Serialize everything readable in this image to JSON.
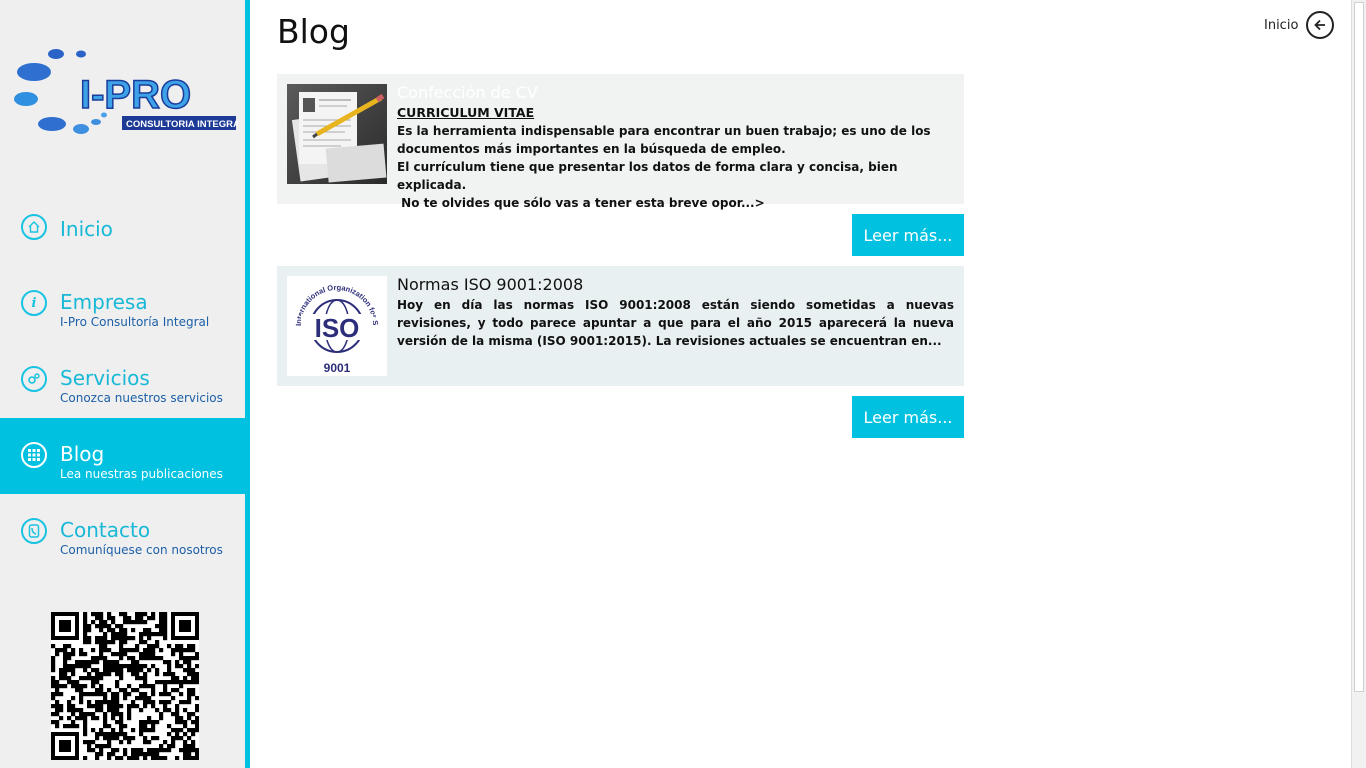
{
  "brand": {
    "logo_text": "I-PRO",
    "logo_tagline": "CONSULTORIA INTEGRAL",
    "primary_color": "#00c2e0",
    "link_color": "#1c5fa8"
  },
  "sidebar": {
    "items": [
      {
        "title": "Inicio",
        "subtitle": "",
        "icon": "home-icon"
      },
      {
        "title": "Empresa",
        "subtitle": "I-Pro Consultoría Integral",
        "icon": "info-icon"
      },
      {
        "title": "Servicios",
        "subtitle": "Conozca nuestros servicios",
        "icon": "gears-icon"
      },
      {
        "title": "Blog",
        "subtitle": "Lea nuestras publicaciones",
        "icon": "grid-icon",
        "active": true
      },
      {
        "title": "Contacto",
        "subtitle": "Comuníquese con nosotros",
        "icon": "phone-icon"
      }
    ]
  },
  "header": {
    "page_title": "Blog",
    "home_link_label": "Inicio"
  },
  "posts": [
    {
      "title": "Confección de CV",
      "subheading": "CURRICULUM VITAE",
      "excerpt_lines": [
        "Es la herramienta indispensable para encontrar un buen trabajo; es uno de los",
        "documentos más importantes en la búsqueda de empleo.",
        "El currículum tiene que presentar los datos de forma clara y concisa, bien explicada.",
        " No te olvides que sólo vas a tener esta breve opor...>"
      ],
      "read_more": "Leer más..."
    },
    {
      "title": "Normas ISO 9001:2008",
      "thumb_ring_text": "International Organization for Standardization",
      "thumb_main": "ISO",
      "thumb_number": "9001",
      "excerpt": "Hoy en día las normas ISO 9001:2008 están siendo sometidas a nuevas revisiones, y todo parece apuntar a que para el año 2015 aparecerá la nueva versión de la misma (ISO 9001:2015). La revisiones actuales se encuentran en...",
      "read_more": "Leer más..."
    }
  ]
}
